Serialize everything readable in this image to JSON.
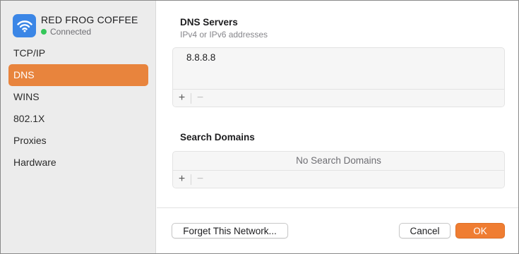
{
  "network": {
    "name": "RED FROG COFFEE",
    "status": "Connected"
  },
  "sidebar": {
    "items": [
      {
        "label": "TCP/IP"
      },
      {
        "label": "DNS"
      },
      {
        "label": "WINS"
      },
      {
        "label": "802.1X"
      },
      {
        "label": "Proxies"
      },
      {
        "label": "Hardware"
      }
    ],
    "selected": "DNS"
  },
  "dns_servers": {
    "title": "DNS Servers",
    "subtitle": "IPv4 or IPv6 addresses",
    "entries": [
      "8.8.8.8"
    ],
    "add_label": "+",
    "remove_label": "−"
  },
  "search_domains": {
    "title": "Search Domains",
    "empty_text": "No Search Domains",
    "add_label": "+",
    "remove_label": "−"
  },
  "buttons": {
    "forget": "Forget This Network...",
    "cancel": "Cancel",
    "ok": "OK"
  },
  "colors": {
    "accent": "#e8843d",
    "ok_button": "#ef7d32",
    "wifi_tile": "#3b86e6",
    "status_connected": "#34c759"
  }
}
